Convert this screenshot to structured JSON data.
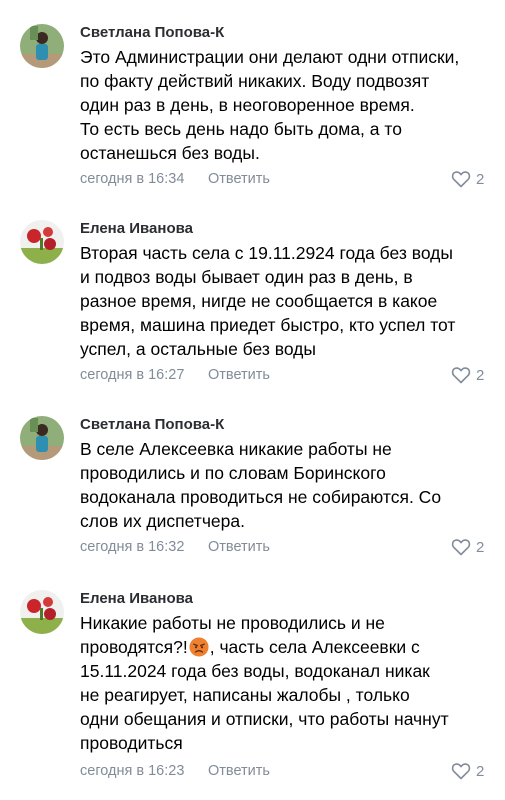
{
  "comments": [
    {
      "author": "Светлана Попова-К",
      "avatar": "avatar-woman-outdoors",
      "lines": [
        "Это Администрации они делают одни отписки,",
        "по факту действий никаких. Воду подвозят",
        "один раз в день, в неоговоренное время.",
        "То есть весь день надо быть дома, а то",
        "останешься без воды."
      ],
      "time": "сегодня в 16:34",
      "reply_label": "Ответить",
      "likes": "2"
    },
    {
      "author": "Елена Иванова",
      "avatar": "avatar-flowers",
      "lines": [
        "Вторая часть села с 19.11.2924 года без воды",
        "и подвоз воды бывает один раз в день, в",
        "разное время, нигде не сообщается в какое",
        "время, машина приедет быстро, кто успел тот",
        "успел, а остальные без воды"
      ],
      "time": "сегодня в 16:27",
      "reply_label": "Ответить",
      "likes": "2"
    },
    {
      "author": "Светлана Попова-К",
      "avatar": "avatar-woman-outdoors",
      "lines": [
        "В селе Алексеевка никакие работы не",
        "проводились и по словам Боринского",
        "водоканала проводиться не собираются. Со",
        "слов их диспетчера."
      ],
      "time": "сегодня в 16:32",
      "reply_label": "Ответить",
      "likes": "2"
    },
    {
      "author": "Елена Иванова",
      "avatar": "avatar-flowers",
      "lines": [
        "Никакие работы не проводились и не",
        "проводятся?!",
        ", часть села Алексеевки с",
        "15.11.2024 года без воды, водоканал никак",
        "не реагирует, написаны жалобы , только",
        "одни обещания и отписки, что работы начнут",
        "проводиться"
      ],
      "emoji": "angry-face-emoji",
      "time": "сегодня в 16:23",
      "reply_label": "Ответить",
      "likes": "2"
    }
  ],
  "colors": {
    "meta": "#818c99",
    "author": "#2b2d31"
  }
}
